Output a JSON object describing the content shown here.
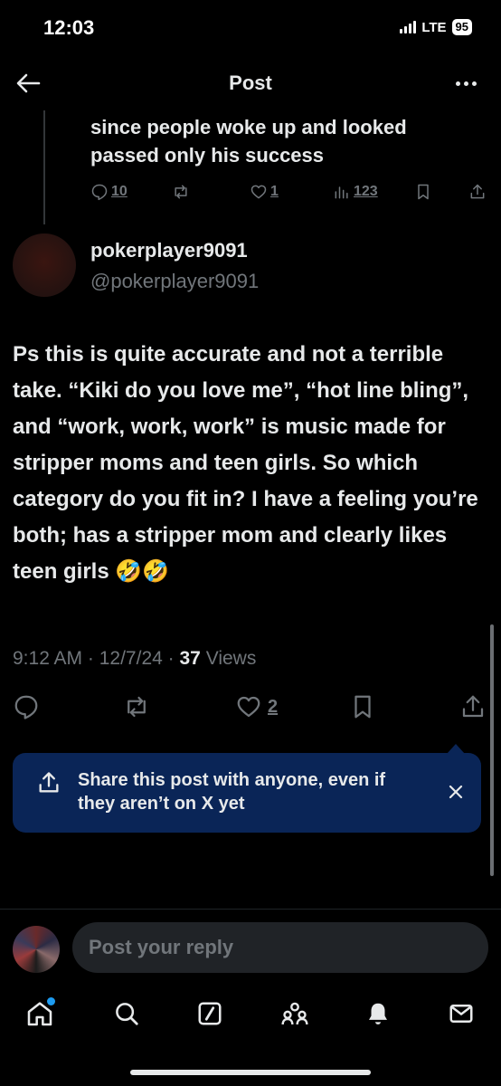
{
  "status_bar": {
    "time": "12:03",
    "network": "LTE",
    "battery": "95"
  },
  "header": {
    "title": "Post",
    "back_icon": "arrow-left-icon",
    "more_icon": "more-horizontal-icon"
  },
  "parent_post": {
    "text": "since people woke up and looked passed only his success",
    "replies": "10",
    "likes": "1",
    "views": "123"
  },
  "post": {
    "author_name": "pokerplayer9091",
    "author_handle": "@pokerplayer9091",
    "text": "Ps this is quite accurate and not a terrible take. “Kiki do you love me”, “hot line bling”, and “work, work, work” is music made for stripper moms and teen girls. So which category do you fit in? I have a feeling you’re both; has a stripper mom and clearly likes teen girls 🤣🤣",
    "time": "9:12 AM",
    "date": "12/7/24",
    "views_count": "37",
    "views_label": "Views",
    "likes": "2"
  },
  "share_tooltip": {
    "text": "Share this post with anyone, even if they aren’t on X yet"
  },
  "reply": {
    "placeholder": "Post your reply"
  },
  "colors": {
    "background": "#000000",
    "text": "#e7e9ea",
    "muted": "#71767b",
    "tooltip_bg": "#0a2557",
    "accent": "#1d9bf0"
  },
  "tabbar": {
    "items": [
      "home-icon",
      "search-icon",
      "grok-icon",
      "communities-icon",
      "notifications-icon",
      "messages-icon"
    ]
  }
}
